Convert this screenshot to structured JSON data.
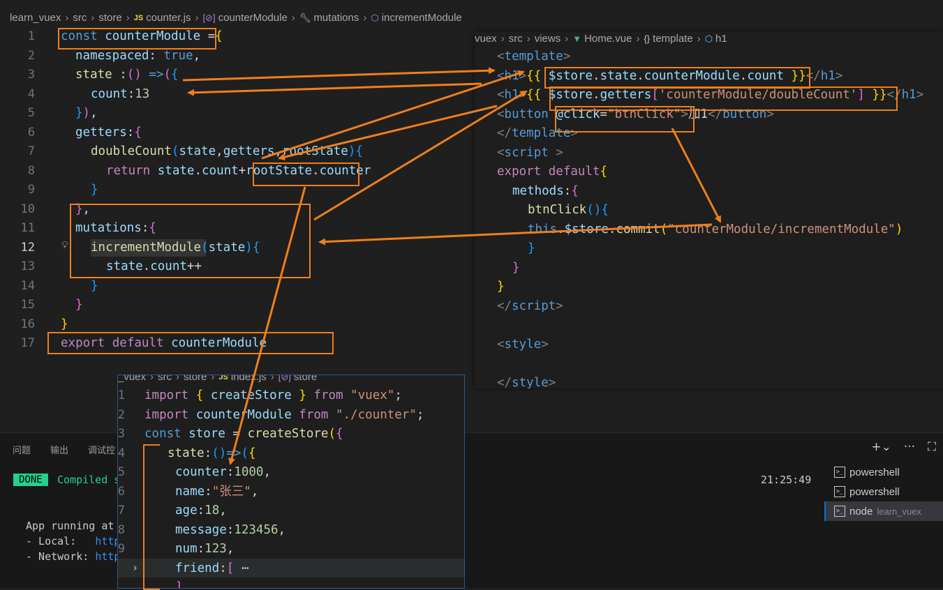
{
  "left_editor": {
    "breadcrumb": {
      "root": "learn_vuex",
      "folder": "src",
      "folder2": "store",
      "file": "counter.js",
      "symbol1": "counterModule",
      "symbol2": "mutations",
      "symbol3": "incrementModule"
    },
    "line_numbers": [
      "1",
      "2",
      "3",
      "4",
      "5",
      "6",
      "7",
      "8",
      "9",
      "10",
      "11",
      "12",
      "13",
      "14",
      "15",
      "16",
      "17"
    ]
  },
  "right_editor": {
    "breadcrumb": {
      "root": "vuex",
      "folder": "src",
      "folder2": "views",
      "file": "Home.vue",
      "symbol1": "template",
      "symbol2": "h1"
    }
  },
  "bottom_editor": {
    "breadcrumb": {
      "root": "_vuex",
      "folder": "src",
      "folder2": "store",
      "file": "index.js",
      "symbol1": "store"
    },
    "line_numbers": [
      "1",
      "2",
      "3",
      "4",
      "5",
      "6",
      "7",
      "8",
      "9"
    ]
  },
  "terminal": {
    "tabs": [
      "问题",
      "输出",
      "调试控"
    ],
    "done_badge": "DONE",
    "compiled_text": "Compiled s",
    "app_running": "App running at",
    "local_label": "- Local:   ",
    "local_link": "http",
    "network_label": "- Network: ",
    "network_link": "http",
    "time": "21:25:49",
    "sessions": [
      {
        "name": "powershell",
        "sub": ""
      },
      {
        "name": "powershell",
        "sub": ""
      },
      {
        "name": "node",
        "sub": "learn_vuex"
      }
    ]
  },
  "colors": {
    "background": "#1f1f1f",
    "annotation": "#f07f1c",
    "keyword": "#569cd6",
    "function": "#dcdcaa",
    "variable": "#9cdcfe",
    "string": "#ce9178",
    "number": "#b5cea8",
    "done_green": "#23d18b"
  }
}
